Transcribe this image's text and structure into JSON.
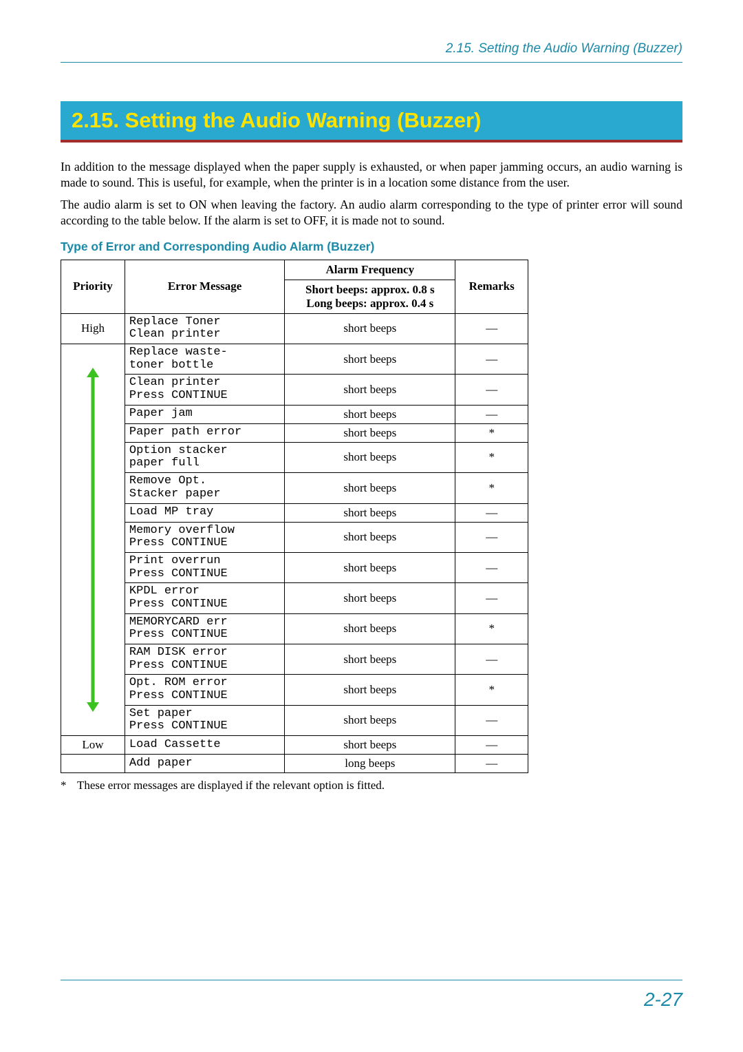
{
  "running_head": "2.15. Setting the Audio Warning (Buzzer)",
  "section_title": "2.15.   Setting the Audio Warning (Buzzer)",
  "para1": "In addition to the message displayed when the paper supply is exhausted, or when paper jamming occurs, an audio warning is made to sound. This is useful, for example, when the printer is in a location some distance from the user.",
  "para2": "The audio alarm is set to ON when leaving the factory. An audio alarm corresponding to the type of printer error will sound according to the table below. If the alarm is set to OFF, it is made not to sound.",
  "subhead": "Type of Error and Corresponding Audio Alarm (Buzzer)",
  "table": {
    "headers": {
      "priority": "Priority",
      "error_message": "Error Message",
      "alarm_frequency": "Alarm Frequency",
      "alarm_sub": "Short beeps: approx. 0.8 s\nLong beeps: approx. 0.4 s",
      "remarks": "Remarks"
    },
    "priority_high": "High",
    "priority_low": "Low",
    "rows": [
      {
        "msg": "Replace Toner\nClean printer",
        "alarm": "short beeps",
        "remark": "—"
      },
      {
        "msg": "Replace   waste-\ntoner bottle",
        "alarm": "short beeps",
        "remark": "—"
      },
      {
        "msg": "Clean printer\nPress CONTINUE",
        "alarm": "short beeps",
        "remark": "—"
      },
      {
        "msg": "Paper jam",
        "alarm": "short beeps",
        "remark": "—"
      },
      {
        "msg": "Paper path error",
        "alarm": "short beeps",
        "remark": "*"
      },
      {
        "msg": "Option stacker\npaper full",
        "alarm": "short beeps",
        "remark": "*"
      },
      {
        "msg": "Remove     Opt.\nStacker paper",
        "alarm": "short beeps",
        "remark": "*"
      },
      {
        "msg": "Load MP tray",
        "alarm": "short beeps",
        "remark": "—"
      },
      {
        "msg": "Memory overflow\nPress CONTINUE",
        "alarm": "short beeps",
        "remark": "—"
      },
      {
        "msg": "Print overrun\nPress CONTINUE",
        "alarm": "short beeps",
        "remark": "—"
      },
      {
        "msg": "KPDL error\nPress CONTINUE",
        "alarm": "short beeps",
        "remark": "—"
      },
      {
        "msg": "MEMORYCARD err\nPress CONTINUE",
        "alarm": "short beeps",
        "remark": "*"
      },
      {
        "msg": "RAM DISK error\nPress CONTINUE",
        "alarm": "short beeps",
        "remark": "—"
      },
      {
        "msg": "Opt. ROM error\nPress CONTINUE",
        "alarm": "short beeps",
        "remark": "*"
      },
      {
        "msg": "Set paper\nPress CONTINUE",
        "alarm": "short beeps",
        "remark": "—"
      },
      {
        "msg": "Load Cassette",
        "alarm": "short beeps",
        "remark": "—"
      },
      {
        "msg": "Add paper",
        "alarm": "long beeps",
        "remark": "—"
      }
    ]
  },
  "footnote": "These error messages are displayed if the relevant option is fitted.",
  "footnote_mark": "*",
  "page_number": "2-27"
}
